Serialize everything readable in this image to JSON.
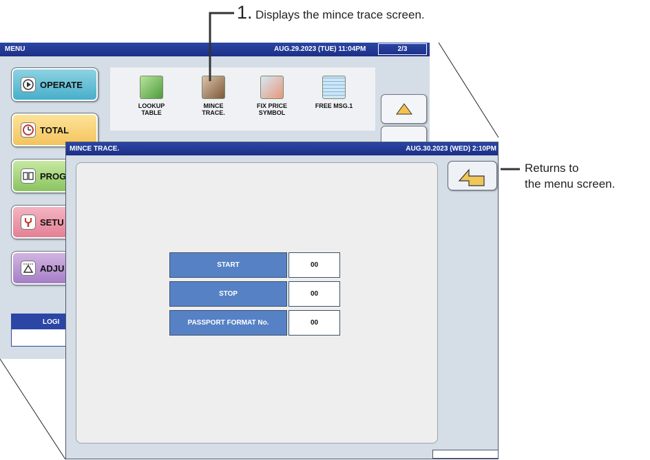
{
  "callouts": {
    "step_number": "1.",
    "step_text": "Displays the mince trace screen.",
    "return_line1": "Returns to",
    "return_line2": "the menu screen."
  },
  "menu_screen": {
    "title": "MENU",
    "datetime": "AUG.29.2023 (TUE) 11:04PM",
    "page": "2/3",
    "side_buttons": [
      {
        "label": "OPERATE",
        "icon": "operate-icon"
      },
      {
        "label": "TOTAL",
        "icon": "clock-icon"
      },
      {
        "label": "PROG",
        "icon": "book-icon"
      },
      {
        "label": "SETU",
        "icon": "setup-wrench-icon"
      },
      {
        "label": "ADJU",
        "icon": "adjust-icon"
      }
    ],
    "icons": [
      {
        "line1": "LOOKUP",
        "line2": "TABLE",
        "icon": "lookup-table-icon"
      },
      {
        "line1": "MINCE",
        "line2": "TRACE.",
        "icon": "mince-trace-icon"
      },
      {
        "line1": "FIX PRICE",
        "line2": "SYMBOL",
        "icon": "fix-price-symbol-icon"
      },
      {
        "line1": "FREE MSG.1",
        "line2": "",
        "icon": "free-msg-icon"
      }
    ],
    "login_label": "LOGI"
  },
  "trace_screen": {
    "title": "MINCE TRACE.",
    "datetime": "AUG.30.2023 (WED)  2:10PM",
    "rows": [
      {
        "label": "START",
        "value": "00"
      },
      {
        "label": "STOP",
        "value": "00"
      },
      {
        "label": "PASSPORT FORMAT No.",
        "value": "00"
      }
    ]
  },
  "colors": {
    "titlebar": "#2b46a5",
    "screen_bg": "#d5dde6",
    "row_label_bg": "#5682c5",
    "return_arrow": "#f0c65a"
  }
}
